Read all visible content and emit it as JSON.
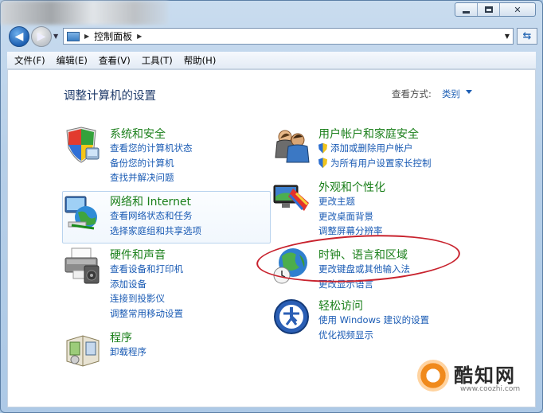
{
  "window": {
    "caption_buttons": [
      "minimize-icon",
      "maximize-icon",
      "close-icon"
    ],
    "close_glyph": "✕"
  },
  "nav": {
    "breadcrumb": "控制面板",
    "back_icon": "arrow-left-icon",
    "forward_icon": "arrow-right-icon"
  },
  "menubar": {
    "items": [
      "文件(F)",
      "编辑(E)",
      "查看(V)",
      "工具(T)",
      "帮助(H)"
    ]
  },
  "main": {
    "title": "调整计算机的设置",
    "view_by_label": "查看方式:",
    "view_by_value": "类别"
  },
  "categories_left": [
    {
      "title": "系统和安全",
      "icon": "shield-icon",
      "links": [
        "查看您的计算机状态",
        "备份您的计算机",
        "查找并解决问题"
      ]
    },
    {
      "title": "网络和 Internet",
      "icon": "network-globe-icon",
      "links": [
        "查看网络状态和任务",
        "选择家庭组和共享选项"
      ]
    },
    {
      "title": "硬件和声音",
      "icon": "printer-icon",
      "links": [
        "查看设备和打印机",
        "添加设备",
        "连接到投影仪",
        "调整常用移动设置"
      ]
    },
    {
      "title": "程序",
      "icon": "programs-box-icon",
      "links": [
        "卸载程序"
      ]
    }
  ],
  "categories_right": [
    {
      "title": "用户帐户和家庭安全",
      "icon": "users-icon",
      "links": [
        "添加或删除用户帐户",
        "为所有用户设置家长控制"
      ]
    },
    {
      "title": "外观和个性化",
      "icon": "display-paint-icon",
      "links": [
        "更改主题",
        "更改桌面背景",
        "调整屏幕分辨率"
      ]
    },
    {
      "title": "时钟、语言和区域",
      "icon": "globe-clock-icon",
      "links": [
        "更改键盘或其他输入法",
        "更改显示语言"
      ]
    },
    {
      "title": "轻松访问",
      "icon": "ease-of-access-icon",
      "links": [
        "使用 Windows 建议的设置",
        "优化视频显示"
      ]
    }
  ],
  "watermark": {
    "brand": "酷知网",
    "url": "www.coozhi.com"
  },
  "colors": {
    "category_title": "#1a7f1a",
    "link": "#1a5bb4",
    "highlight_ellipse": "#c8222d"
  }
}
